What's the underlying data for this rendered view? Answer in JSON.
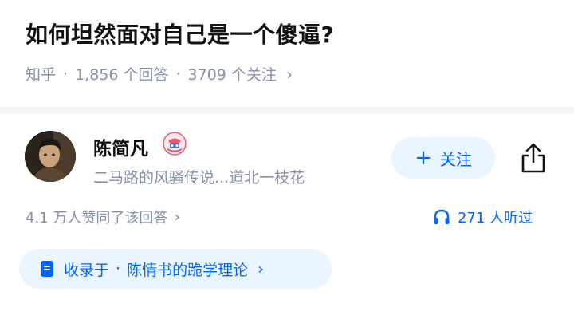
{
  "question": {
    "title": "如何坦然面对自己是一个傻逼?",
    "source": "知乎",
    "separator": "·",
    "answers_count": "1,856 个回答",
    "followers_count": "3709 个关注",
    "chevron": "›"
  },
  "author": {
    "name": "陈简凡",
    "headline": "二马路的风骚传说...道北一枝花",
    "avatar_icon": "avatar-photo",
    "badge_icon": "badge-icon"
  },
  "follow_button": {
    "plus": "+",
    "label": "关注"
  },
  "share_icon": "share-icon",
  "stats": {
    "upvotes": "4.1 万人赞同了该回答",
    "chevron": "›",
    "listens": "271 人听过",
    "listen_icon": "headphones-icon"
  },
  "collection": {
    "prefix": "收录于",
    "separator": "·",
    "name": "陈情书的跪学理论",
    "chevron": "›",
    "icon": "book-icon"
  },
  "colors": {
    "accent": "#0066ff",
    "accent_bg": "#ebf5ff",
    "meta_gray": "#8590a6",
    "text": "#121212",
    "page_bg": "#f2f3f5"
  }
}
